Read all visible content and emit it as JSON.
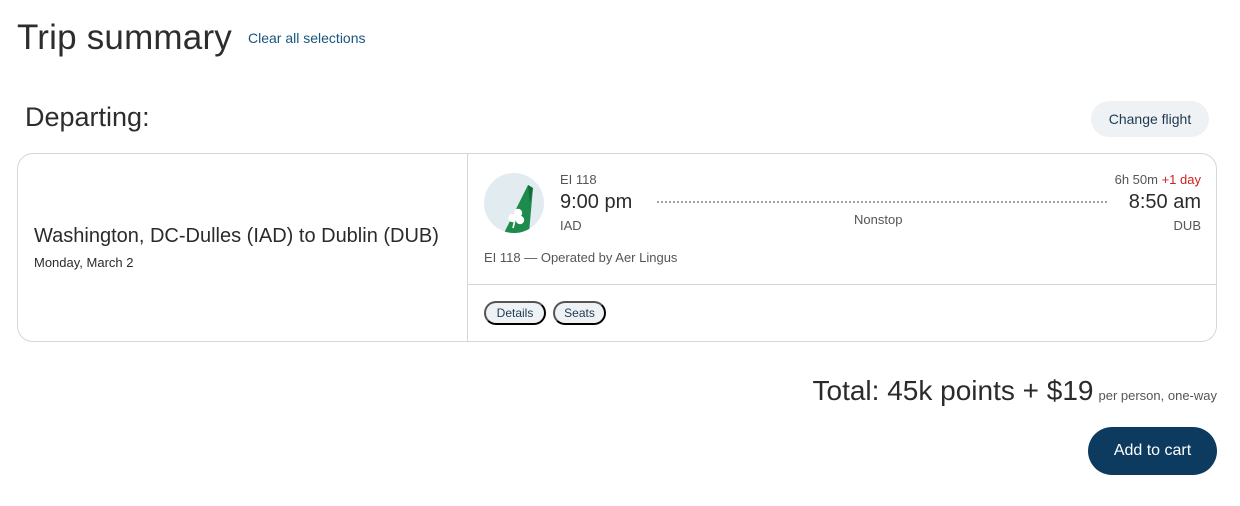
{
  "header": {
    "title": "Trip summary",
    "clear_label": "Clear all selections"
  },
  "segment": {
    "heading": "Departing:",
    "change_label": "Change flight",
    "route": "Washington, DC-Dulles (IAD) to Dublin (DUB)",
    "date": "Monday, March 2"
  },
  "flight": {
    "airline_logo_icon": "aer-lingus-shamrock-tail-icon",
    "flight_number": "EI 118",
    "depart_time": "9:00 pm",
    "depart_code": "IAD",
    "stops": "Nonstop",
    "duration": "6h 50m",
    "day_change": "+1 day",
    "arrive_time": "8:50 am",
    "arrive_code": "DUB",
    "operated_by": "EI 118 — Operated by Aer Lingus",
    "details_label": "Details",
    "seats_label": "Seats"
  },
  "summary": {
    "total": "Total: 45k points + $19",
    "total_note": "per person, one-way",
    "add_to_cart_label": "Add to cart"
  },
  "colors": {
    "link": "#18557f",
    "primary_button": "#0c3b5f",
    "pill_background": "#eef2f4",
    "day_change": "#d0201b",
    "logo_green": "#1e8a4c"
  }
}
